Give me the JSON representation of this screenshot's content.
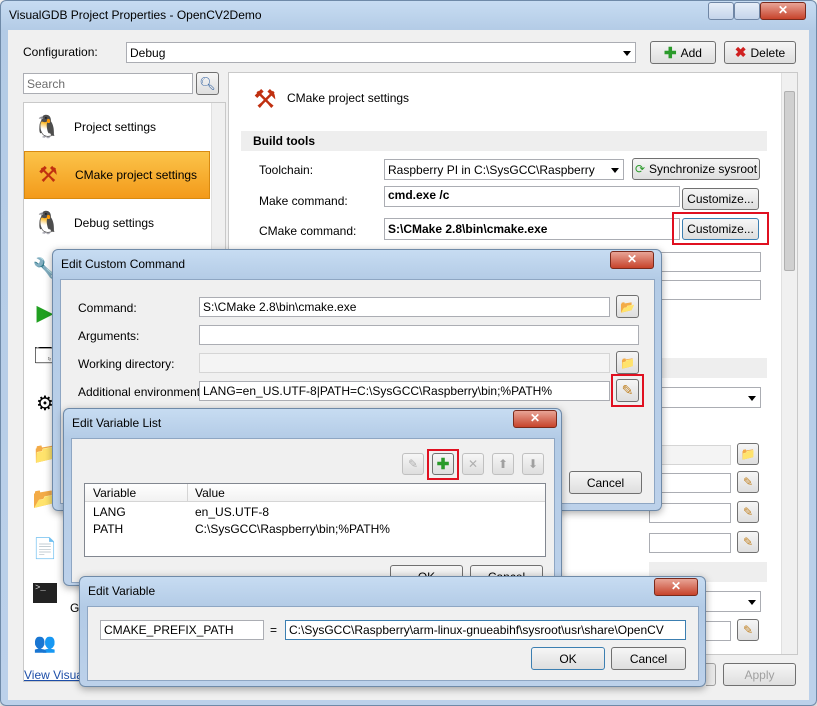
{
  "main_window": {
    "title": "VisualGDB Project Properties - OpenCV2Demo",
    "configuration_label": "Configuration:",
    "configuration_value": "Debug",
    "add_label": "Add",
    "delete_label": "Delete",
    "search_placeholder": "Search",
    "view_link": "View VisualG",
    "apply_label": "Apply",
    "nav_items": [
      {
        "label": "Project settings",
        "icon": "linux-penguin-icon"
      },
      {
        "label": "CMake project settings",
        "icon": "hammer-icon"
      },
      {
        "label": "Debug settings",
        "icon": "linux-penguin-icon"
      }
    ],
    "extra_nav_letter": "G"
  },
  "cmake_page": {
    "title": "CMake project settings",
    "section_build_tools": "Build tools",
    "toolchain_label": "Toolchain:",
    "toolchain_value": "Raspberry PI in C:\\SysGCC\\Raspberry",
    "sync_label": "Synchronize sysroot",
    "make_label": "Make command:",
    "make_value": "cmd.exe /c",
    "customize_label": "Customize...",
    "cmake_label": "CMake command:",
    "cmake_value": "S:\\CMake 2.8\\bin\\cmake.exe"
  },
  "custom_command_dialog": {
    "title": "Edit Custom Command",
    "command_label": "Command:",
    "command_value": "S:\\CMake 2.8\\bin\\cmake.exe",
    "arguments_label": "Arguments:",
    "arguments_value": "",
    "workdir_label": "Working directory:",
    "workdir_value": "",
    "env_label": "Additional environment:",
    "env_value": "LANG=en_US.UTF-8|PATH=C:\\SysGCC\\Raspberry\\bin;%PATH%",
    "cancel_label": "Cancel"
  },
  "variable_list_dialog": {
    "title": "Edit Variable List",
    "col_variable": "Variable",
    "col_value": "Value",
    "rows": [
      {
        "variable": "LANG",
        "value": "en_US.UTF-8"
      },
      {
        "variable": "PATH",
        "value": "C:\\SysGCC\\Raspberry\\bin;%PATH%"
      }
    ],
    "ok_label": "OK",
    "cancel_label": "Cancel"
  },
  "edit_variable_dialog": {
    "title": "Edit Variable",
    "name_value": "CMAKE_PREFIX_PATH",
    "equals": "=",
    "value_value": "C:\\SysGCC\\Raspberry\\arm-linux-gnueabihf\\sysroot\\usr\\share\\OpenCV",
    "ok_label": "OK",
    "cancel_label": "Cancel"
  },
  "highlight_color": "#e01020"
}
